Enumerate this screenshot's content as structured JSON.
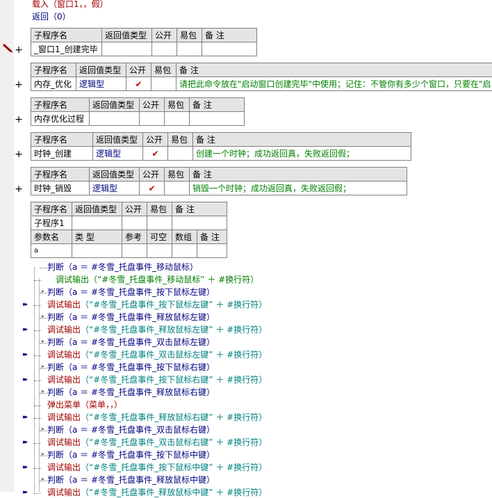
{
  "header": {
    "line1": "载入（窗口1，，假）",
    "line2": "返回（0）"
  },
  "columns": {
    "name": "子程序名",
    "ret": "返回值类型",
    "public": "公开",
    "easy": "易包",
    "note": "备 注"
  },
  "subs": [
    {
      "name": "_窗口1_创建完毕",
      "ret": "",
      "public": "",
      "note": ""
    },
    {
      "name": "内存_优化",
      "ret": "逻辑型",
      "public": "✔",
      "note": "请把此命令放在\"启动窗口创建完毕\"中使用；记住：不管你有多少个窗口，只要在\"启"
    },
    {
      "name": "内存优化过程",
      "ret": "",
      "public": "",
      "note": ""
    },
    {
      "name": "时钟_创建",
      "ret": "逻辑型",
      "public": "✔",
      "note": "创建一个时钟；成功返回真，失败返回假；"
    },
    {
      "name": "时钟_销毁",
      "ret": "逻辑型",
      "public": "✔",
      "note": "销毁一个时钟；成功返回真，失败返回假；"
    },
    {
      "name": "子程序1",
      "ret": "",
      "public": "",
      "note": ""
    }
  ],
  "params": {
    "headers": [
      "参数名",
      "类 型",
      "参考",
      "可空",
      "数组",
      "备 注"
    ],
    "row": [
      "a",
      "",
      "",
      "",
      "",
      ""
    ]
  },
  "code": [
    {
      "kw": "判断",
      "text": "（a ＝ #冬雪_托盘事件_移动鼠标）",
      "kind": "judge"
    },
    {
      "kw": "调试输出",
      "text": "（“#冬雪_托盘事件_移动鼠标” ＋ #换行符）",
      "kind": "comment"
    },
    {
      "kw": "判断",
      "text": "（a ＝ #冬雪_托盘事件_按下鼠标左键）",
      "kind": "judge"
    },
    {
      "kw": "调试输出",
      "text": "（“#冬雪_托盘事件_按下鼠标左键” ＋ #换行符）",
      "kind": "debug"
    },
    {
      "kw": "判断",
      "text": "（a ＝ #冬雪_托盘事件_释放鼠标左键）",
      "kind": "judge"
    },
    {
      "kw": "调试输出",
      "text": "（“#冬雪_托盘事件_释放鼠标左键” ＋ #换行符）",
      "kind": "debug"
    },
    {
      "kw": "判断",
      "text": "（a ＝ #冬雪_托盘事件_双击鼠标左键）",
      "kind": "judge"
    },
    {
      "kw": "调试输出",
      "text": "（“#冬雪_托盘事件_双击鼠标左键” ＋ #换行符）",
      "kind": "debug"
    },
    {
      "kw": "判断",
      "text": "（a ＝ #冬雪_托盘事件_按下鼠标右键）",
      "kind": "judge"
    },
    {
      "kw": "调试输出",
      "text": "（“#冬雪_托盘事件_按下鼠标右键” ＋ #换行符）",
      "kind": "debug"
    },
    {
      "kw": "判断",
      "text": "（a ＝ #冬雪_托盘事件_释放鼠标右键）",
      "kind": "judge"
    },
    {
      "kw": "弹出菜单",
      "text": "（菜单，，）",
      "kind": "popup"
    },
    {
      "kw": "调试输出",
      "text": "（“#冬雪_托盘事件_释放鼠标右键” ＋ #换行符）",
      "kind": "debug"
    },
    {
      "kw": "判断",
      "text": "（a ＝ #冬雪_托盘事件_双击鼠标右键）",
      "kind": "judge"
    },
    {
      "kw": "调试输出",
      "text": "（“#冬雪_托盘事件_双击鼠标右键” ＋ #换行符）",
      "kind": "debug"
    },
    {
      "kw": "判断",
      "text": "（a ＝ #冬雪_托盘事件_按下鼠标中键）",
      "kind": "judge"
    },
    {
      "kw": "调试输出",
      "text": "（“#冬雪_托盘事件_按下鼠标中键” ＋ #换行符）",
      "kind": "debug"
    },
    {
      "kw": "判断",
      "text": "（a ＝ #冬雪_托盘事件_释放鼠标中键）",
      "kind": "judge"
    },
    {
      "kw": "调试输出",
      "text": "（“#冬雪_托盘事件_释放鼠标中键” ＋ #换行符）",
      "kind": "debug"
    }
  ],
  "colors": {
    "keyword_red": "#a00000",
    "keyword_blue": "#000080",
    "string_teal": "#008080",
    "comment_green": "#008000",
    "check_red": "#c00000"
  },
  "icons": {
    "expand": "plus",
    "current_line": "pen-icon",
    "fold": "double-arrow"
  }
}
